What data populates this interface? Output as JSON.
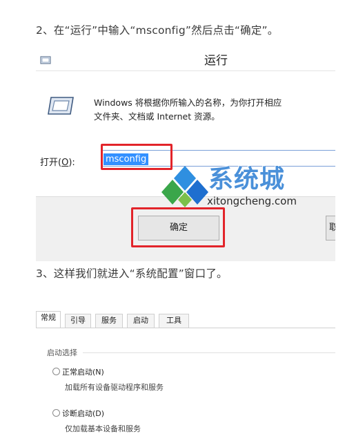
{
  "step2": "2、在“运行”中输入“msconfig”然后点击“确定”。",
  "run_dialog": {
    "title": "运行",
    "desc_line1": "Windows 将根据你所输入的名称，为你打开相应",
    "desc_line2": "文件夹、文档或 Internet 资源。",
    "open_label_prefix": "打开(",
    "open_label_key": "O",
    "open_label_suffix": "):",
    "input_value": "msconfig",
    "ok_label": "确定",
    "cancel_label": "取",
    "brand_icon": "diamond-logo-icon",
    "accent_red": "#e2242a",
    "selection_blue": "#3390ff"
  },
  "watermark": {
    "brand": "系统城",
    "url": "xitongcheng.com"
  },
  "step3": "3、这样我们就进入“系统配置”窗口了。",
  "sysconfig": {
    "tabs": [
      "常规",
      "引导",
      "服务",
      "启动",
      "工具"
    ],
    "group_label": "启动选择",
    "options": [
      {
        "label": "正常启动(N)",
        "desc": "加载所有设备驱动程序和服务"
      },
      {
        "label": "诊断启动(D)",
        "desc": "仅加载基本设备和服务"
      }
    ]
  }
}
